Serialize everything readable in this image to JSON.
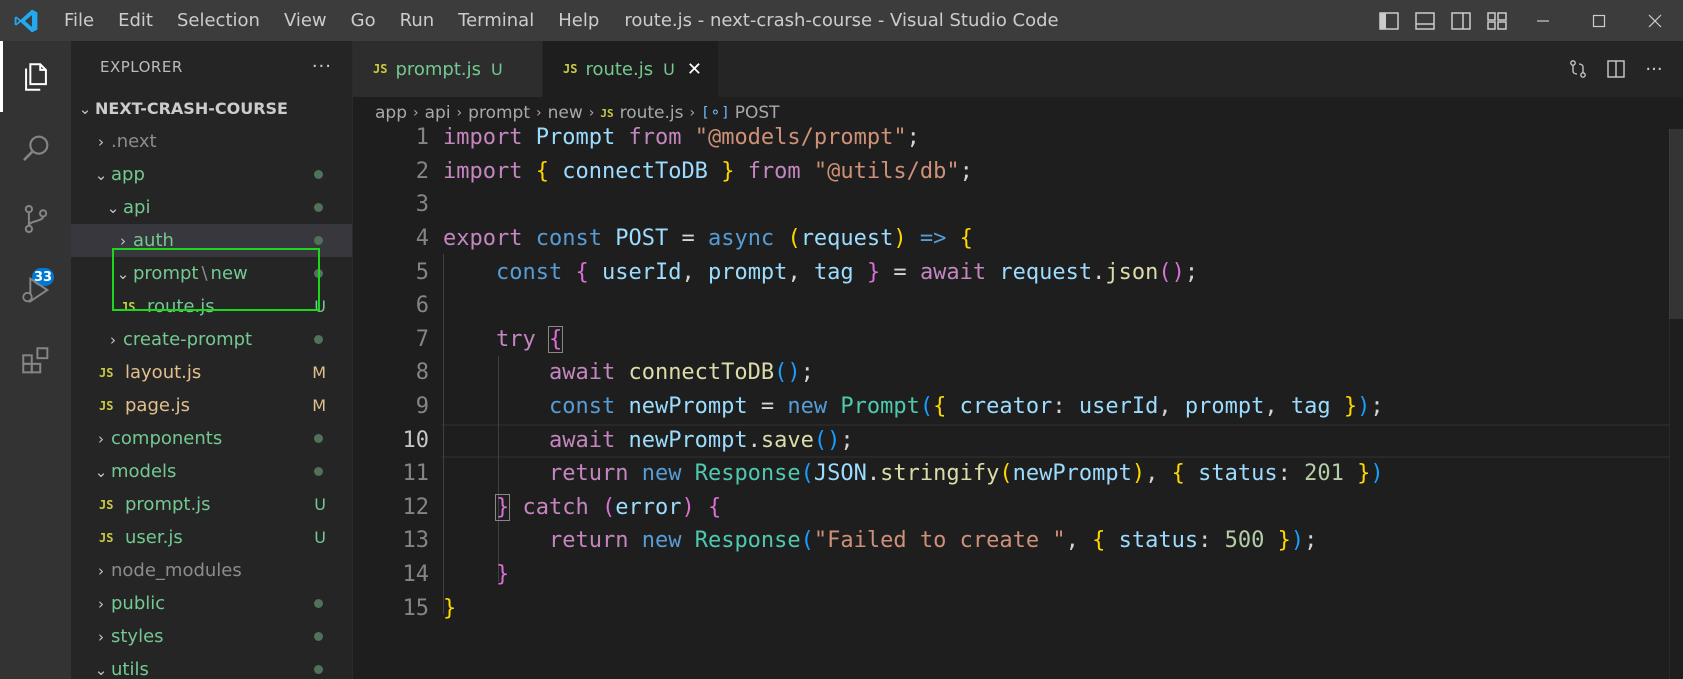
{
  "titlebar": {
    "menu": [
      "File",
      "Edit",
      "Selection",
      "View",
      "Go",
      "Run",
      "Terminal",
      "Help"
    ],
    "window_title": "route.js - next-crash-course - Visual Studio Code"
  },
  "activitybar": {
    "scm_badge": "33"
  },
  "sidebar": {
    "title": "EXPLORER",
    "more": "···",
    "root": "NEXT-CRASH-COURSE",
    "items": [
      {
        "label": ".next",
        "chevron": "›",
        "status": ""
      },
      {
        "label": "app",
        "chevron": "⌄",
        "status": "dot"
      },
      {
        "label": "api",
        "chevron": "⌄",
        "status": "dot"
      },
      {
        "label": "auth",
        "chevron": "›",
        "status": "dot"
      },
      {
        "label_a": "prompt",
        "label_sep": "\\",
        "label_b": "new",
        "chevron": "⌄",
        "status": "dot"
      },
      {
        "label": "route.js",
        "icon": "JS",
        "status": "U"
      },
      {
        "label": "create-prompt",
        "chevron": "›",
        "status": "dot"
      },
      {
        "label": "layout.js",
        "icon": "JS",
        "status": "M"
      },
      {
        "label": "page.js",
        "icon": "JS",
        "status": "M"
      },
      {
        "label": "components",
        "chevron": "›",
        "status": "dot"
      },
      {
        "label": "models",
        "chevron": "⌄",
        "status": "dot"
      },
      {
        "label": "prompt.js",
        "icon": "JS",
        "status": "U"
      },
      {
        "label": "user.js",
        "icon": "JS",
        "status": "U"
      },
      {
        "label": "node_modules",
        "chevron": "›",
        "status": ""
      },
      {
        "label": "public",
        "chevron": "›",
        "status": "dot"
      },
      {
        "label": "styles",
        "chevron": "›",
        "status": "dot"
      },
      {
        "label": "utils",
        "chevron": "⌄",
        "status": "dot"
      }
    ]
  },
  "tabs": [
    {
      "icon": "JS",
      "label": "prompt.js",
      "status": "U",
      "close": ""
    },
    {
      "icon": "JS",
      "label": "route.js",
      "status": "U",
      "close": "✕"
    }
  ],
  "breadcrumb": {
    "parts": [
      "app",
      "api",
      "prompt",
      "new"
    ],
    "file_icon": "JS",
    "file": "route.js",
    "symbol_icon": "[⚬]",
    "symbol": "POST"
  },
  "editor": {
    "line_numbers": [
      "1",
      "2",
      "3",
      "4",
      "5",
      "6",
      "7",
      "8",
      "9",
      "10",
      "11",
      "12",
      "13",
      "14",
      "15"
    ],
    "current_line": "10"
  },
  "colors": {
    "accent": "#0078d4",
    "highlight_box": "#1ed61e",
    "untracked": "#73c991",
    "modified": "#e2c08d"
  }
}
